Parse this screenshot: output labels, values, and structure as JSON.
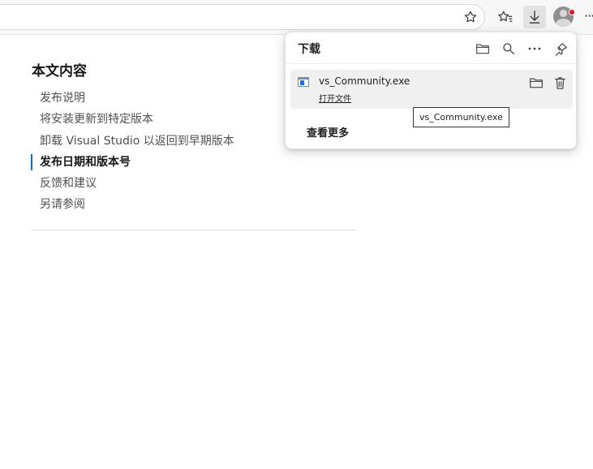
{
  "browser": {
    "toolbar_icons": [
      "favorite-star-icon",
      "favorites-icon",
      "downloads-icon",
      "profile-icon",
      "more-options-icon"
    ],
    "more_label": "···"
  },
  "toc": {
    "title": "本文内容",
    "items": [
      {
        "label": "发布说明",
        "active": false
      },
      {
        "label": "将安装更新到特定版本",
        "active": false
      },
      {
        "label": "卸载 Visual Studio 以返回到早期版本",
        "active": false
      },
      {
        "label": "发布日期和版本号",
        "active": true
      },
      {
        "label": "反馈和建议",
        "active": false
      },
      {
        "label": "另请参阅",
        "active": false
      }
    ]
  },
  "downloads": {
    "title": "下载",
    "header_icons": [
      "open-folder-icon",
      "search-icon",
      "more-icon",
      "pin-icon"
    ],
    "items": [
      {
        "filename": "vs_Community.exe",
        "action": "打开文件",
        "icons": [
          "show-in-folder-icon",
          "delete-icon"
        ]
      }
    ],
    "see_more": "查看更多",
    "tooltip": "vs_Community.exe"
  },
  "colors": {
    "active_marker": "#0f6cbd",
    "notification_dot": "#e81123"
  }
}
